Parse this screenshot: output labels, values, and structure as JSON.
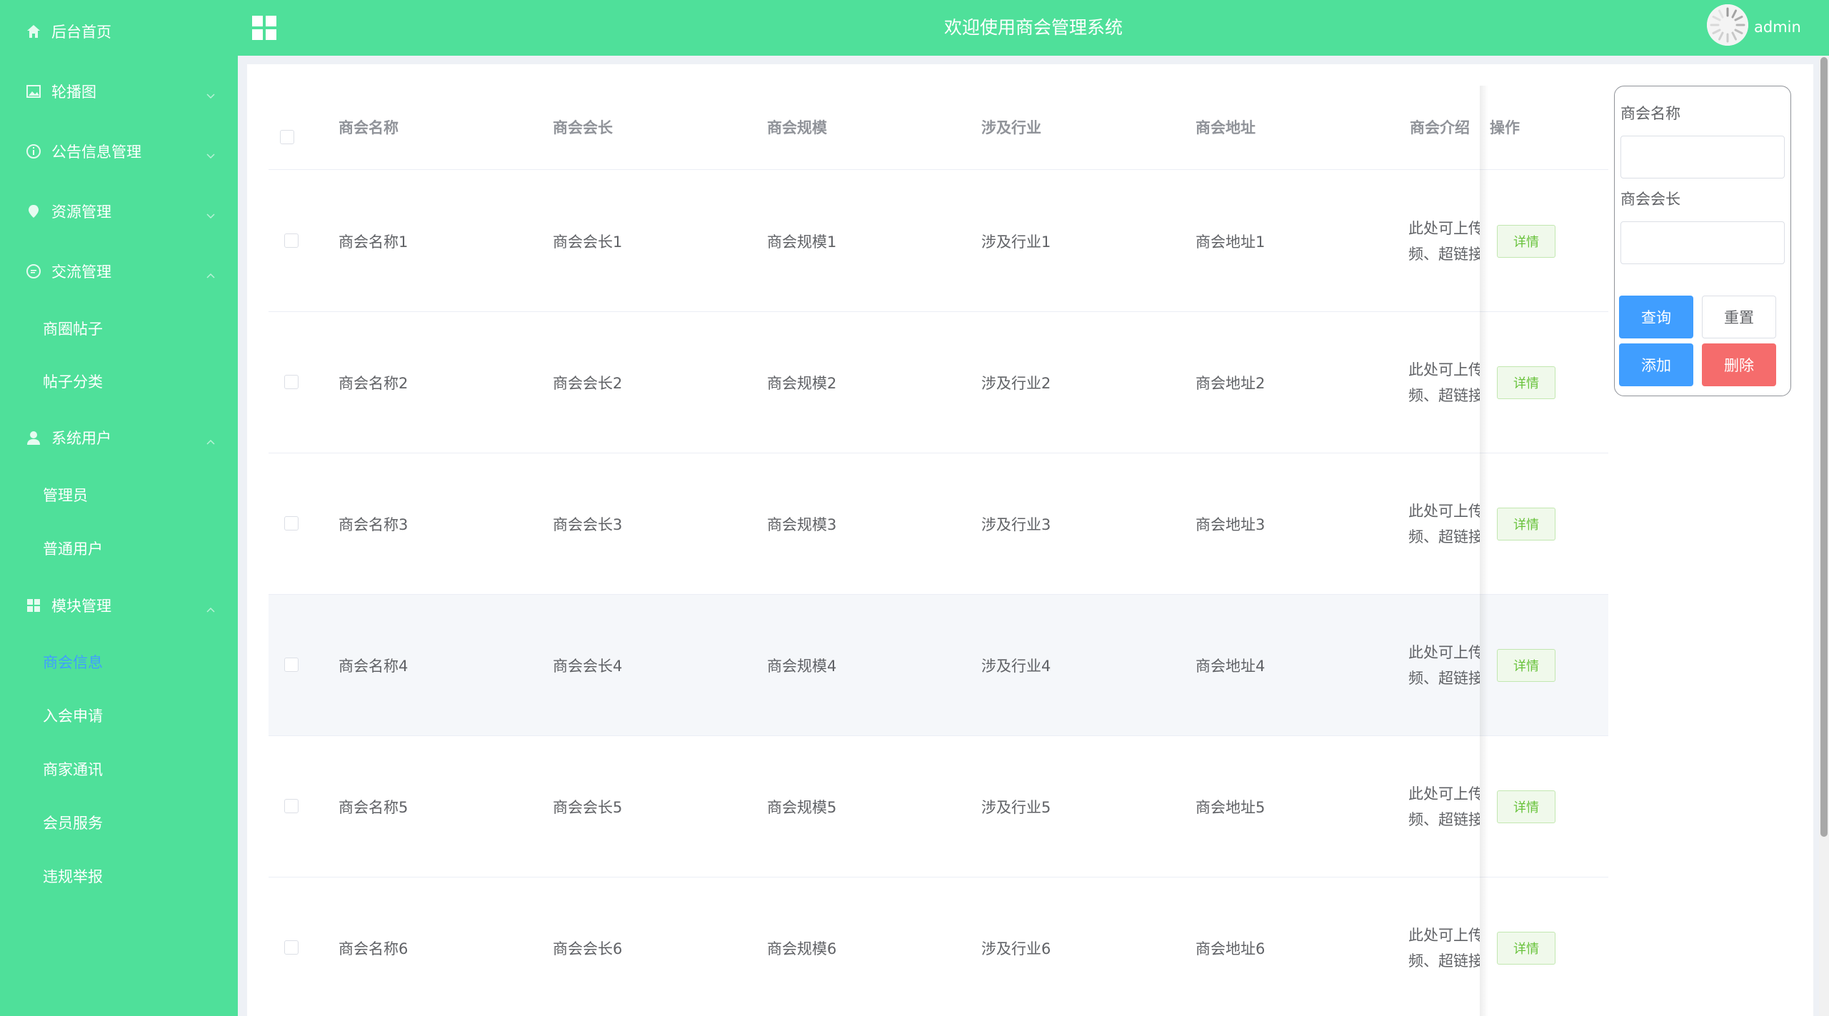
{
  "header": {
    "title": "欢迎使用商会管理系统",
    "username": "admin"
  },
  "sidebar": {
    "items": [
      {
        "label": "后台首页",
        "icon": "home-icon"
      },
      {
        "label": "轮播图",
        "icon": "picture-icon"
      },
      {
        "label": "公告信息管理",
        "icon": "info-icon"
      },
      {
        "label": "资源管理",
        "icon": "location-icon"
      },
      {
        "label": "交流管理",
        "icon": "chat-icon"
      },
      {
        "label": "商圈帖子"
      },
      {
        "label": "帖子分类"
      },
      {
        "label": "系统用户",
        "icon": "user-icon"
      },
      {
        "label": "管理员"
      },
      {
        "label": "普通用户"
      },
      {
        "label": "模块管理",
        "icon": "menu-icon"
      },
      {
        "label": "商会信息",
        "active": true
      },
      {
        "label": "入会申请"
      },
      {
        "label": "商家通讯"
      },
      {
        "label": "会员服务"
      },
      {
        "label": "违规举报"
      }
    ]
  },
  "table": {
    "columns": [
      "商会名称",
      "商会会长",
      "商会规模",
      "涉及行业",
      "商会地址",
      "商会介绍",
      "操作"
    ],
    "rows": [
      {
        "name": "商会名称1",
        "president": "商会会长1",
        "scale": "商会规模1",
        "industry": "涉及行业1",
        "address": "商会地址1",
        "intro1": "此处可上传",
        "intro2": "频、超链接",
        "action": "详情"
      },
      {
        "name": "商会名称2",
        "president": "商会会长2",
        "scale": "商会规模2",
        "industry": "涉及行业2",
        "address": "商会地址2",
        "intro1": "此处可上传",
        "intro2": "频、超链接",
        "action": "详情"
      },
      {
        "name": "商会名称3",
        "president": "商会会长3",
        "scale": "商会规模3",
        "industry": "涉及行业3",
        "address": "商会地址3",
        "intro1": "此处可上传",
        "intro2": "频、超链接",
        "action": "详情"
      },
      {
        "name": "商会名称4",
        "president": "商会会长4",
        "scale": "商会规模4",
        "industry": "涉及行业4",
        "address": "商会地址4",
        "intro1": "此处可上传",
        "intro2": "频、超链接",
        "action": "详情"
      },
      {
        "name": "商会名称5",
        "president": "商会会长5",
        "scale": "商会规模5",
        "industry": "涉及行业5",
        "address": "商会地址5",
        "intro1": "此处可上传",
        "intro2": "频、超链接",
        "action": "详情"
      },
      {
        "name": "商会名称6",
        "president": "商会会长6",
        "scale": "商会规模6",
        "industry": "涉及行业6",
        "address": "商会地址6",
        "intro1": "此处可上传",
        "intro2": "频、超链接",
        "action": "详情"
      }
    ]
  },
  "search": {
    "name_label": "商会名称",
    "name_value": "",
    "president_label": "商会会长",
    "president_value": "",
    "query_label": "查询",
    "reset_label": "重置",
    "add_label": "添加",
    "delete_label": "删除"
  },
  "colors": {
    "brand": "#4fe09a",
    "primary": "#409eff",
    "danger": "#f56c6c",
    "success": "#67c23a"
  }
}
